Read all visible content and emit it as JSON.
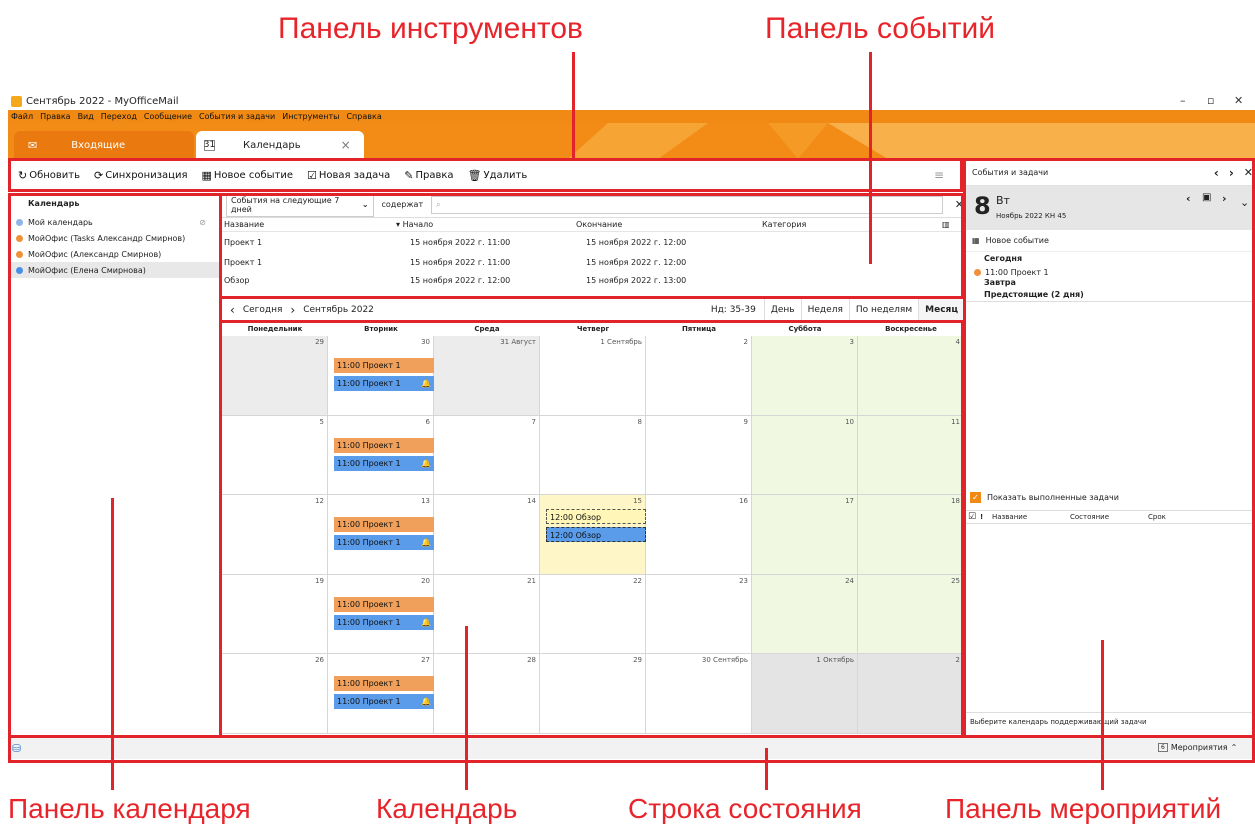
{
  "callouts": {
    "toolbar": "Панель инструментов",
    "events": "Панель событий",
    "calendar_pane": "Панель календаря",
    "calendar": "Календарь",
    "statusbar": "Строка состояния",
    "agenda": "Панель мероприятий"
  },
  "window": {
    "title": "Сентябрь 2022 - MyOfficeMail",
    "controls": {
      "minimize": "–",
      "restore": "▫",
      "close": "✕"
    }
  },
  "menu": [
    "Файл",
    "Правка",
    "Вид",
    "Переход",
    "Сообщение",
    "События и задачи",
    "Инструменты",
    "Справка"
  ],
  "tabs": [
    {
      "label": "Входящие",
      "icon": "envelope-icon"
    },
    {
      "label": "Календарь",
      "icon": "calendar-icon",
      "close": "×"
    }
  ],
  "toolbar": {
    "refresh": "Обновить",
    "sync": "Синхронизация",
    "new_event": "Новое событие",
    "new_task": "Новая задача",
    "edit": "Правка",
    "delete": "Удалить"
  },
  "calendar_list": {
    "header": "Календарь",
    "items": [
      {
        "label": "Мой календарь",
        "color": "#8fb5e8"
      },
      {
        "label": "МойОфис (Tasks Александр Смирнов)",
        "color": "#f0913a"
      },
      {
        "label": "МойОфис (Александр Смирнов)",
        "color": "#f0913a"
      },
      {
        "label": "МойОфис (Елена Смирнова)",
        "color": "#4a8fe6"
      }
    ]
  },
  "events_panel": {
    "filter": "События на следующие 7 дней",
    "contains": "содержат",
    "columns": {
      "name": "Название",
      "start": "Начало",
      "end": "Окончание",
      "category": "Категория"
    },
    "rows": [
      {
        "name": "Проект 1",
        "start": "15 ноября 2022 г. 11:00",
        "end": "15 ноября 2022 г. 12:00"
      },
      {
        "name": "Проект 1",
        "start": "15 ноября 2022 г. 11:00",
        "end": "15 ноября 2022 г. 12:00"
      },
      {
        "name": "Обзор",
        "start": "15 ноября 2022 г. 12:00",
        "end": "15 ноября 2022 г. 13:00"
      }
    ]
  },
  "nav": {
    "today": "Сегодня",
    "period": "Сентябрь 2022",
    "week_range": "Нд: 35-39",
    "views": [
      "День",
      "Неделя",
      "По неделям",
      "Месяц"
    ]
  },
  "grid": {
    "days": [
      "Понедельник",
      "Вторник",
      "Среда",
      "Четверг",
      "Пятница",
      "Суббота",
      "Воскресенье"
    ],
    "weeks": [
      [
        "29",
        "30",
        "31 Август",
        "1 Сентябрь",
        "2",
        "3",
        "4"
      ],
      [
        "5",
        "6",
        "7",
        "8",
        "9",
        "10",
        "11"
      ],
      [
        "12",
        "13",
        "14",
        "15",
        "16",
        "17",
        "18"
      ],
      [
        "19",
        "20",
        "21",
        "22",
        "23",
        "24",
        "25"
      ],
      [
        "26",
        "27",
        "28",
        "29",
        "30 Сентябрь",
        "1 Октябрь",
        "2"
      ]
    ],
    "event_project": "11:00 Проект 1",
    "event_review": "12:00 Обзор"
  },
  "agenda": {
    "title": "События и задачи",
    "day": "8",
    "weekday": "Вт",
    "subtitle": "Ноябрь 2022  КН 45",
    "new_event": "Новое событие",
    "today": "Сегодня",
    "today_item": "11:00 Проект 1",
    "tomorrow": "Завтра",
    "upcoming": "Предстоящие (2 дня)",
    "show_done": "Показать выполненные задачи",
    "task_cols": {
      "check": "☑",
      "priority": "!",
      "name": "Название",
      "state": "Состояние",
      "due": "Срок"
    },
    "footer": "Выберите календарь поддерживающий задачи"
  },
  "status": {
    "agenda_toggle": "Мероприятия"
  }
}
